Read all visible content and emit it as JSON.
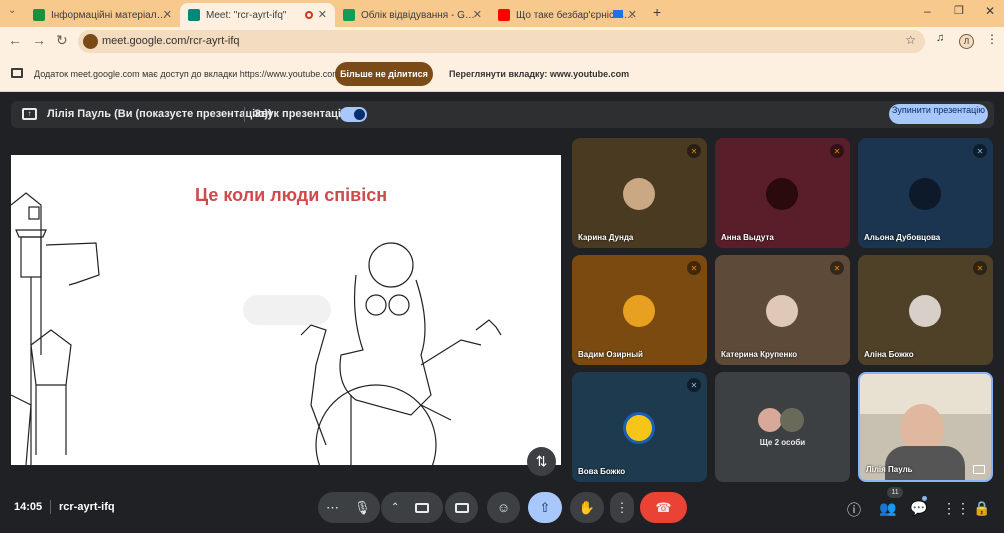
{
  "browser": {
    "tabs": [
      {
        "title": "Інформаційні матеріали в рам",
        "color": "#1e8e3e"
      },
      {
        "title": "Meet: \"rcr-ayrt-ifq\"",
        "color": "#00897b"
      },
      {
        "title": "Облік відвідування - Google T",
        "color": "#0f9d58"
      },
      {
        "title": "Що таке безбар'єрність і ч",
        "color": "#ff0000"
      }
    ],
    "url": "meet.google.com/rcr-ayrt-ifq",
    "profile_initial": "Л"
  },
  "infobar": {
    "text": "Додаток meet.google.com має доступ до вкладки https://www.youtube.com",
    "stop_label": "Більше не ділитися",
    "view_label": "Переглянути вкладку: www.youtube.com"
  },
  "presenting": {
    "name": "Лілія Пауль (Ви (показуєте презентацію))",
    "sound_label": "Звук презентації",
    "stop_label": "Зупинити презентацію"
  },
  "slide": {
    "title": "Це коли люди співісн"
  },
  "participants": [
    {
      "name": "Карина Дунда",
      "bg": "#4a3a22"
    },
    {
      "name": "Анна Выдута",
      "bg": "#5a1e2a"
    },
    {
      "name": "Альона Дубовцова",
      "bg": "#1b3550"
    },
    {
      "name": "Вадим Озирный",
      "bg": "#7a4a10"
    },
    {
      "name": "Катерина Крупенко",
      "bg": "#5e4a38"
    },
    {
      "name": "Аліна Божко",
      "bg": "#4e4128"
    },
    {
      "name": "Вова Божко",
      "bg": "#1e3a4e"
    }
  ],
  "more": {
    "label": "Ще 2 особи"
  },
  "self": {
    "name": "Лілія Пауль"
  },
  "meeting": {
    "time": "14:05",
    "code": "rcr-ayrt-ifq",
    "people_count": "11"
  }
}
